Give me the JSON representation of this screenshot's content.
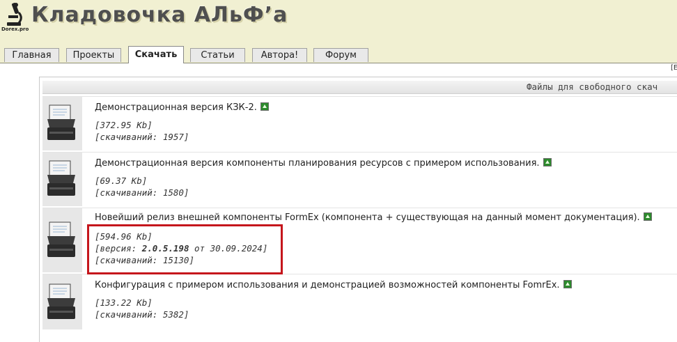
{
  "header": {
    "site_title": "Кладовочка АЛьФ’а",
    "logo_caption": "Dorex.pro"
  },
  "tabs": [
    {
      "label": "Главная",
      "active": false
    },
    {
      "label": "Проекты",
      "active": false
    },
    {
      "label": "Скачать",
      "active": true
    },
    {
      "label": "Статьи",
      "active": false
    },
    {
      "label": "Автора!",
      "active": false
    },
    {
      "label": "Форум",
      "active": false
    }
  ],
  "edge_mark": "[Е",
  "files": {
    "section_title": "Файлы для свободного скач",
    "items": [
      {
        "title": "Демонстрационная версия КЗК-2.",
        "size": "[372.95 Kb]",
        "downloads": "[скачиваний: 1957]"
      },
      {
        "title": "Демонстрационная версия компоненты планирования ресурсов с примером использования.",
        "size": "[69.37 Kb]",
        "downloads": "[скачиваний: 1580]"
      },
      {
        "title": "Новейший релиз внешней компоненты FormEx (компонента + существующая на данный момент документация).",
        "size": "[594.96 Kb]",
        "version_prefix": "[версия: ",
        "version_number": "2.0.5.198",
        "version_suffix": " от 30.09.2024]",
        "downloads": "[скачиваний: 15130]"
      },
      {
        "title": "Конфигурация с примером использования и демонстрацией возможностей компоненты FomrEx.",
        "size": "[133.22 Kb]",
        "downloads": "[скачиваний: 5382]"
      }
    ]
  },
  "colors": {
    "header_bg": "#f1f0d2",
    "highlight": "#c5161c",
    "download_icon": "#2d8a2d"
  }
}
